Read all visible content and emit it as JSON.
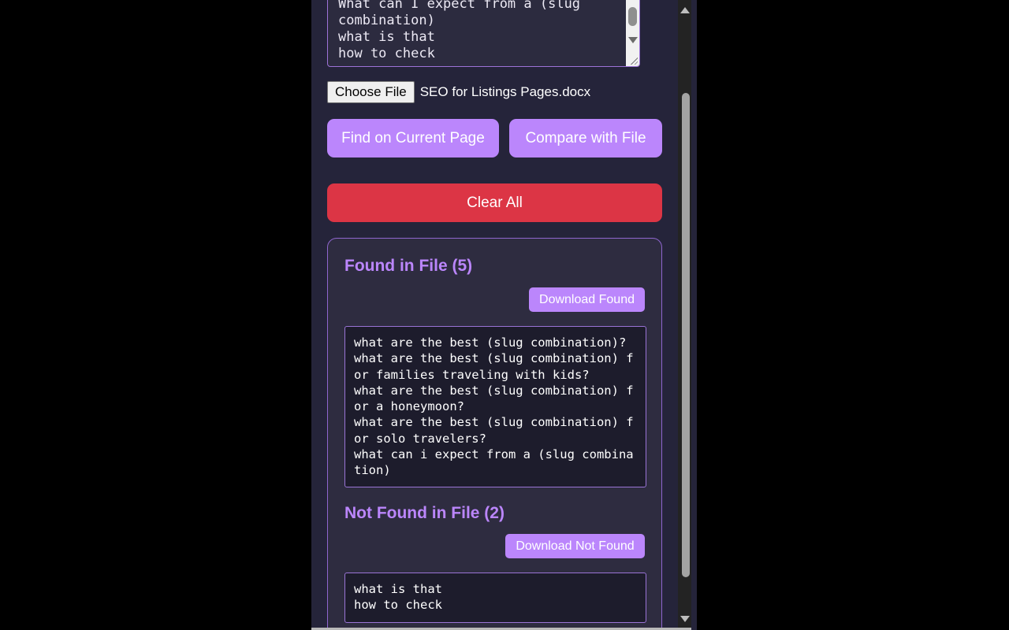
{
  "input": {
    "text": "What can I expect from a (slug\ncombination)\nwhat is that\nhow to check"
  },
  "file": {
    "button_label": "Choose File",
    "selected_name": "SEO for Listings Pages.docx"
  },
  "actions": {
    "find_label": "Find on Current Page",
    "compare_label": "Compare with File",
    "clear_label": "Clear All"
  },
  "results": {
    "found": {
      "title": "Found in File (5)",
      "download_label": "Download Found",
      "items": [
        "what are the best (slug combination)?",
        "what are the best (slug combination) for families traveling with kids?",
        "what are the best (slug combination) for a honeymoon?",
        "what are the best (slug combination) for solo travelers?",
        "what can i expect from a (slug combination)"
      ]
    },
    "not_found": {
      "title": "Not Found in File (2)",
      "download_label": "Download Not Found",
      "items": [
        "what is that",
        "how to check"
      ]
    }
  },
  "colors": {
    "accent": "#bb86fc",
    "danger": "#dc3545",
    "background": "#25243a"
  }
}
